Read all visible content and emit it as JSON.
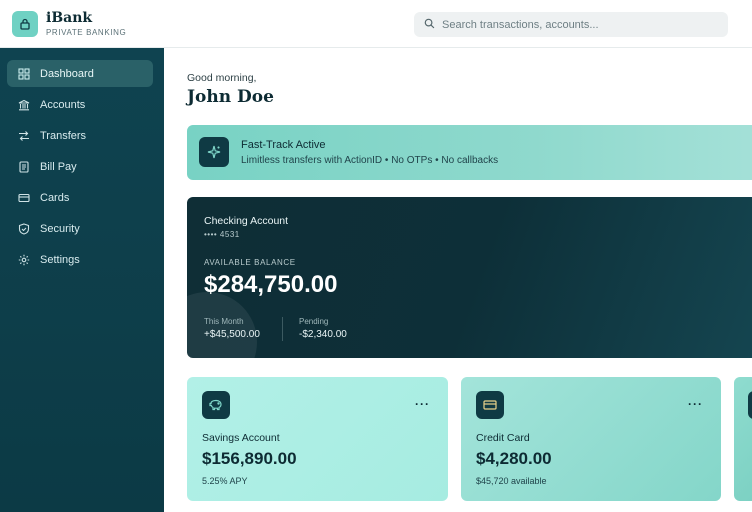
{
  "brand": {
    "name": "iBank",
    "tagline": "PRIVATE BANKING"
  },
  "search": {
    "placeholder": "Search transactions, accounts..."
  },
  "sidebar": {
    "items": [
      {
        "label": "Dashboard",
        "icon": "grid-icon",
        "active": true
      },
      {
        "label": "Accounts",
        "icon": "bank-icon"
      },
      {
        "label": "Transfers",
        "icon": "transfer-arrows-icon"
      },
      {
        "label": "Bill Pay",
        "icon": "receipt-icon"
      },
      {
        "label": "Cards",
        "icon": "credit-card-icon"
      },
      {
        "label": "Security",
        "icon": "shield-icon"
      },
      {
        "label": "Settings",
        "icon": "gear-icon"
      }
    ]
  },
  "greeting": {
    "salutation": "Good morning,",
    "name": "John Doe"
  },
  "banner": {
    "title": "Fast-Track Active",
    "subtitle": "Limitless transfers with ActionID • No OTPs • No callbacks",
    "icon": "sparkle-icon"
  },
  "checking": {
    "title": "Checking Account",
    "masked_number": "•••• 4531",
    "balance_label": "AVAILABLE BALANCE",
    "balance": "$284,750.00",
    "this_month_label": "This Month",
    "this_month_value": "+$45,500.00",
    "pending_label": "Pending",
    "pending_value": "-$2,340.00"
  },
  "cards": [
    {
      "title": "Savings Account",
      "amount": "$156,890.00",
      "sub": "5.25% APY",
      "icon": "piggy-bank-icon",
      "more": "···"
    },
    {
      "title": "Credit Card",
      "amount": "$4,280.00",
      "sub": "$45,720 available",
      "icon": "credit-card-icon",
      "more": "···"
    }
  ],
  "colors": {
    "sidebar": "#0f4350",
    "accent": "#6fd1c3",
    "dark_card": "#0f2e36"
  }
}
